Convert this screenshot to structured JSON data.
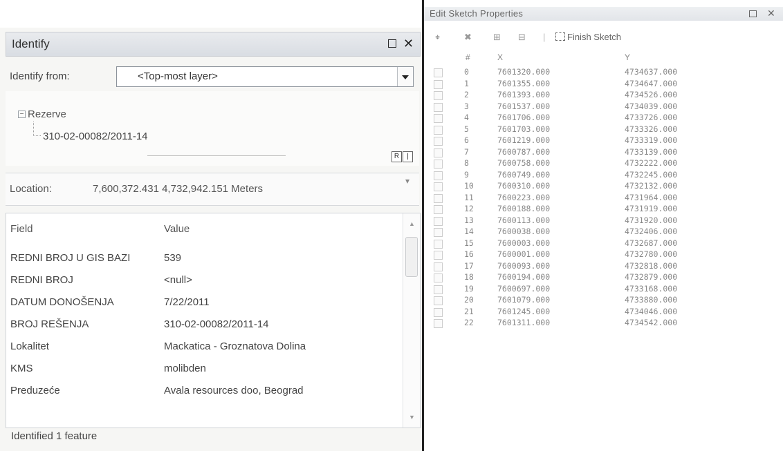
{
  "identify": {
    "title": "Identify",
    "identify_from_label": "Identify from:",
    "identify_from_value": "<Top-most layer>",
    "tree": {
      "layer": "Rezerve",
      "feature": "310-02-00082/2011-14"
    },
    "location_label": "Location:",
    "location_value": "7,600,372.431  4,732,942.151 Meters",
    "columns": {
      "field": "Field",
      "value": "Value"
    },
    "rows": [
      {
        "field": "REDNI BROJ U GIS BAZI",
        "value": "539"
      },
      {
        "field": "REDNI BROJ",
        "value": "<null>"
      },
      {
        "field": "DATUM DONOŠENJA",
        "value": "7/22/2011"
      },
      {
        "field": "BROJ REŠENJA",
        "value": "310-02-00082/2011-14"
      },
      {
        "field": "Lokalitet",
        "value": "Mackatica - Groznatova Dolina"
      },
      {
        "field": "KMS",
        "value": "molibden"
      },
      {
        "field": "Preduzeće",
        "value": "Avala resources doo, Beograd"
      }
    ],
    "status": "Identified 1 feature"
  },
  "sketch": {
    "title": "Edit Sketch Properties",
    "finish_label": "Finish Sketch",
    "columns": {
      "num": "#",
      "x": "X",
      "y": "Y"
    },
    "vertices": [
      {
        "n": "0",
        "x": "7601320.000",
        "y": "4734637.000"
      },
      {
        "n": "1",
        "x": "7601355.000",
        "y": "4734647.000"
      },
      {
        "n": "2",
        "x": "7601393.000",
        "y": "4734526.000"
      },
      {
        "n": "3",
        "x": "7601537.000",
        "y": "4734039.000"
      },
      {
        "n": "4",
        "x": "7601706.000",
        "y": "4733726.000"
      },
      {
        "n": "5",
        "x": "7601703.000",
        "y": "4733326.000"
      },
      {
        "n": "6",
        "x": "7601219.000",
        "y": "4733319.000"
      },
      {
        "n": "7",
        "x": "7600787.000",
        "y": "4733139.000"
      },
      {
        "n": "8",
        "x": "7600758.000",
        "y": "4732222.000"
      },
      {
        "n": "9",
        "x": "7600749.000",
        "y": "4732245.000"
      },
      {
        "n": "10",
        "x": "7600310.000",
        "y": "4732132.000"
      },
      {
        "n": "11",
        "x": "7600223.000",
        "y": "4731964.000"
      },
      {
        "n": "12",
        "x": "7600188.000",
        "y": "4731919.000"
      },
      {
        "n": "13",
        "x": "7600113.000",
        "y": "4731920.000"
      },
      {
        "n": "14",
        "x": "7600038.000",
        "y": "4732406.000"
      },
      {
        "n": "15",
        "x": "7600003.000",
        "y": "4732687.000"
      },
      {
        "n": "16",
        "x": "7600001.000",
        "y": "4732780.000"
      },
      {
        "n": "17",
        "x": "7600093.000",
        "y": "4732818.000"
      },
      {
        "n": "18",
        "x": "7600194.000",
        "y": "4732879.000"
      },
      {
        "n": "19",
        "x": "7600697.000",
        "y": "4733168.000"
      },
      {
        "n": "20",
        "x": "7601079.000",
        "y": "4733880.000"
      },
      {
        "n": "21",
        "x": "7601245.000",
        "y": "4734046.000"
      },
      {
        "n": "22",
        "x": "7601311.000",
        "y": "4734542.000"
      }
    ]
  }
}
